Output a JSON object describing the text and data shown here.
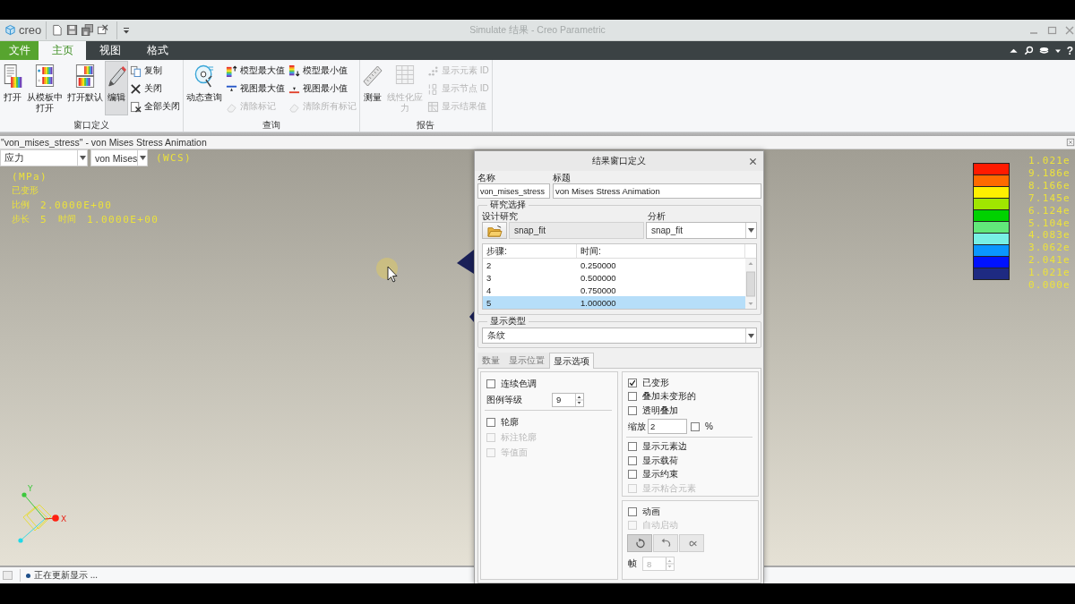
{
  "window": {
    "logo": "creo",
    "title": "Simulate 结果 - Creo Parametric"
  },
  "ribbon": {
    "tabs": [
      {
        "label": "文件",
        "kind": "file",
        "selected": false
      },
      {
        "label": "主页",
        "kind": "tab",
        "selected": true
      },
      {
        "label": "视图",
        "kind": "tab",
        "selected": false
      },
      {
        "label": "格式",
        "kind": "tab",
        "selected": false
      }
    ],
    "help": "?",
    "groups": [
      {
        "label": "窗口定义",
        "items": [
          {
            "label": "打开",
            "kind": "large",
            "disabled": false,
            "pressed": false
          },
          {
            "label": "从模板中打开",
            "kind": "large",
            "disabled": false,
            "pressed": false
          },
          {
            "label": "打开默认",
            "kind": "large",
            "disabled": false,
            "pressed": false
          },
          {
            "label": "编辑",
            "kind": "large",
            "disabled": false,
            "pressed": true
          },
          {
            "label": "复制",
            "kind": "small",
            "disabled": false,
            "pressed": false
          },
          {
            "label": "关闭",
            "kind": "small",
            "disabled": false,
            "pressed": false
          },
          {
            "label": "全部关闭",
            "kind": "small",
            "disabled": false,
            "pressed": false
          }
        ]
      },
      {
        "label": "查询",
        "items": [
          {
            "label": "动态查询",
            "kind": "large",
            "disabled": false,
            "pressed": false
          },
          {
            "label": "模型最大值",
            "kind": "small",
            "disabled": false,
            "pressed": false
          },
          {
            "label": "视图最大值",
            "kind": "small",
            "disabled": false,
            "pressed": false
          },
          {
            "label": "清除标记",
            "kind": "small",
            "disabled": true,
            "pressed": false
          },
          {
            "label": "模型最小值",
            "kind": "small",
            "disabled": false,
            "pressed": false
          },
          {
            "label": "视图最小值",
            "kind": "small",
            "disabled": false,
            "pressed": false
          },
          {
            "label": "清除所有标记",
            "kind": "small",
            "disabled": true,
            "pressed": false
          }
        ]
      },
      {
        "label": "报告",
        "items": [
          {
            "label": "测量",
            "kind": "large",
            "disabled": false,
            "pressed": false
          },
          {
            "label": "线性化应力",
            "kind": "large",
            "disabled": true,
            "pressed": false
          },
          {
            "label": "显示元素 ID",
            "kind": "small",
            "disabled": true,
            "pressed": false
          },
          {
            "label": "显示节点 ID",
            "kind": "small",
            "disabled": true,
            "pressed": false
          },
          {
            "label": "显示结果值",
            "kind": "small",
            "disabled": true,
            "pressed": false
          }
        ]
      }
    ]
  },
  "viewport": {
    "title": "\"von_mises_stress\" - von Mises Stress Animation",
    "quantity": "应力",
    "component": "von Mises",
    "coordinate_system": "(WCS)",
    "info": [
      [
        {
          "text": "(MPa)",
          "kind": "value"
        }
      ],
      [
        {
          "text": "已变形",
          "kind": "label"
        }
      ],
      [
        {
          "text": "比例",
          "kind": "label"
        },
        {
          "text": "2.0000E+00",
          "kind": "value"
        }
      ],
      [
        {
          "text": "步长",
          "kind": "label"
        },
        {
          "text": "5",
          "kind": "value"
        },
        {
          "text": "时间",
          "kind": "label"
        },
        {
          "text": "1.0000E+00",
          "kind": "value"
        }
      ]
    ],
    "legend": {
      "labels": [
        "1.021e",
        "9.186e",
        "8.166e",
        "7.145e",
        "6.124e",
        "5.104e",
        "4.083e",
        "3.062e",
        "2.041e",
        "1.021e",
        "0.000e"
      ],
      "bands": [
        {
          "color": "#ff1a00"
        },
        {
          "color": "#ff6a00"
        },
        {
          "color": "#fff000"
        },
        {
          "color": "#a0e600"
        },
        {
          "color": "#00d200"
        },
        {
          "color": "#62e87a"
        },
        {
          "color": "#78f0e4"
        },
        {
          "color": "#0a96ff"
        },
        {
          "color": "#0012ff"
        },
        {
          "color": "#1e2a82"
        }
      ]
    },
    "triad": {
      "labels": [
        "Y",
        "X"
      ]
    }
  },
  "dialog": {
    "title": "结果窗口定义",
    "name": {
      "label": "名称",
      "value": "von_mises_stress"
    },
    "caption": {
      "label": "标题",
      "value": "von Mises Stress Animation"
    },
    "study_selection": {
      "title": "研究选择",
      "design_study": {
        "label": "设计研究",
        "value": "snap_fit"
      },
      "analysis": {
        "label": "分析",
        "value": "snap_fit"
      },
      "table": {
        "columns": [
          "步骤:",
          "时间:"
        ],
        "rows": [
          {
            "step": "2",
            "time": "0.250000",
            "selected": false
          },
          {
            "step": "3",
            "time": "0.500000",
            "selected": false
          },
          {
            "step": "4",
            "time": "0.750000",
            "selected": false
          },
          {
            "step": "5",
            "time": "1.000000",
            "selected": true
          }
        ]
      }
    },
    "display_type": {
      "title": "显示类型",
      "value": "条纹"
    },
    "tabs": [
      {
        "label": "数量",
        "selected": false
      },
      {
        "label": "显示位置",
        "selected": false
      },
      {
        "label": "显示选项",
        "selected": true
      }
    ],
    "left_panel": {
      "sections": [
        [
          {
            "kind": "checkbox",
            "label": "连续色调",
            "checked": false,
            "disabled": false
          },
          {
            "kind": "spinner",
            "label": "图例等级",
            "value": "9",
            "disabled": false
          }
        ],
        [
          {
            "kind": "checkbox",
            "label": "轮廓",
            "checked": false,
            "disabled": false
          },
          {
            "kind": "checkbox",
            "label": "标注轮廓",
            "checked": false,
            "disabled": true
          },
          {
            "kind": "checkbox",
            "label": "等值面",
            "checked": false,
            "disabled": true
          }
        ]
      ]
    },
    "options_panel": {
      "sections": [
        [
          {
            "kind": "checkbox",
            "label": "已变形",
            "checked": true,
            "disabled": false
          },
          {
            "kind": "checkbox",
            "label": "叠加未变形的",
            "checked": false,
            "disabled": false
          },
          {
            "kind": "checkbox",
            "label": "透明叠加",
            "checked": false,
            "disabled": false
          },
          {
            "kind": "scale",
            "label": "缩放",
            "value": "2",
            "unit": {
              "label": "%",
              "checked": false
            }
          }
        ],
        [
          {
            "kind": "checkbox",
            "label": "显示元素边",
            "checked": false,
            "disabled": false
          },
          {
            "kind": "checkbox",
            "label": "显示载荷",
            "checked": false,
            "disabled": false
          },
          {
            "kind": "checkbox",
            "label": "显示约束",
            "checked": false,
            "disabled": false
          },
          {
            "kind": "checkbox",
            "label": "显示粘合元素",
            "checked": false,
            "disabled": true
          }
        ]
      ]
    },
    "animation_panel": {
      "sections": [
        [
          {
            "kind": "checkbox",
            "label": "动画",
            "checked": false,
            "disabled": false
          },
          {
            "kind": "checkbox",
            "label": "自动启动",
            "checked": false,
            "disabled": true
          },
          {
            "kind": "modes",
            "modes": [
              {
                "selected": true
              },
              {
                "selected": false
              },
              {
                "selected": false
              }
            ]
          },
          {
            "kind": "spinner",
            "label": "帧",
            "value": "8",
            "disabled": true
          }
        ]
      ]
    }
  },
  "status_bar": {
    "message": "正在更新显示 ..."
  }
}
